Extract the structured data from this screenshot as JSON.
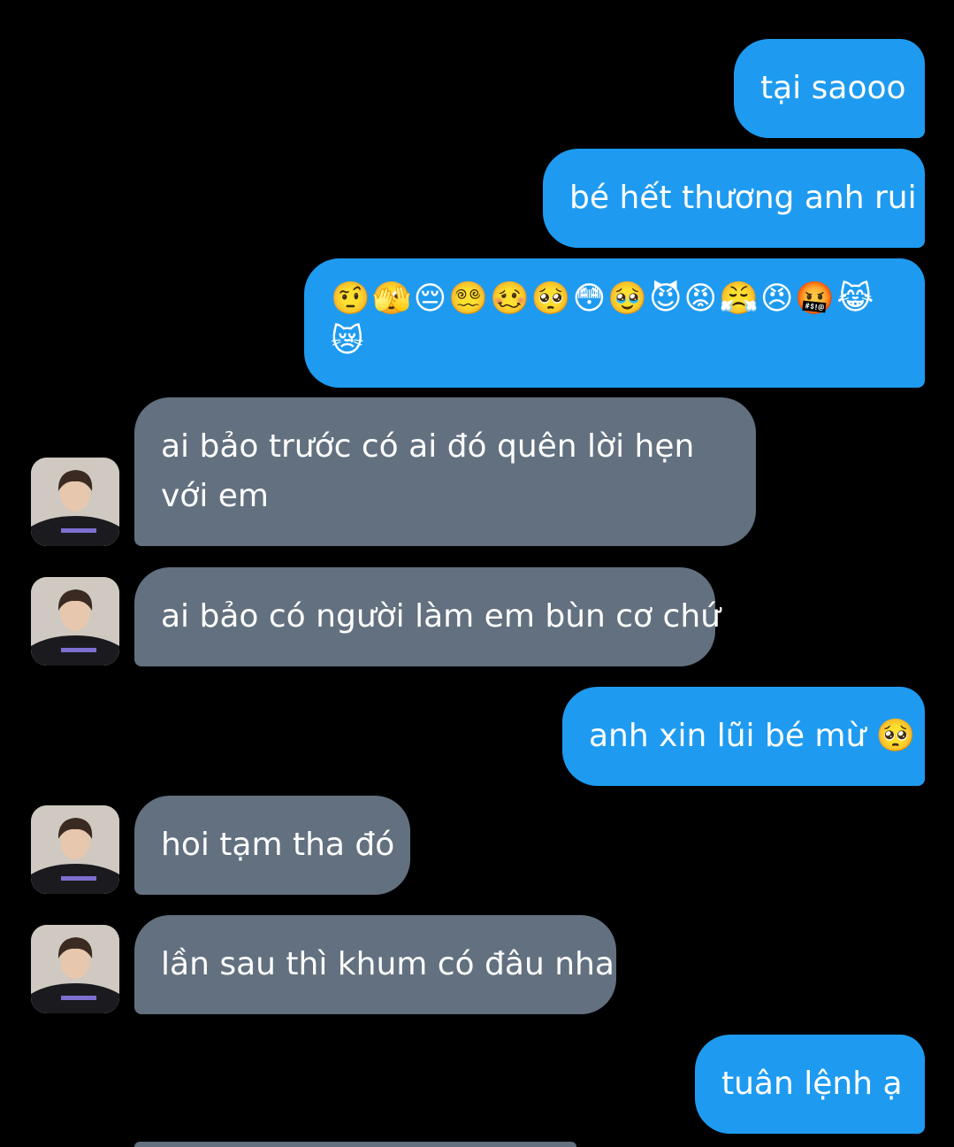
{
  "messages": [
    {
      "side": "sent",
      "text": "tại saooo"
    },
    {
      "side": "sent",
      "text": "bé hết thương anh rui"
    },
    {
      "side": "sent",
      "text": "🤨🫣😔😵‍💫🥴🥺😳🥹😈😡😤😠🤬😹😿"
    },
    {
      "side": "received",
      "text": "ai bảo trước có ai đó quên lời hẹn với em"
    },
    {
      "side": "received",
      "text": "ai bảo có người làm em bùn cơ chứ"
    },
    {
      "side": "sent",
      "text": "anh xin lũi bé mừ 🥺"
    },
    {
      "side": "received",
      "text": "hoi tạm tha đó"
    },
    {
      "side": "received",
      "text": "lần sau thì khum có đâu nha"
    },
    {
      "side": "sent",
      "text": "tuân lệnh ạ"
    }
  ],
  "colors": {
    "background": "#000000",
    "sent_bubble": "#1e9bf0",
    "received_bubble": "#62707f",
    "text": "#ffffff"
  },
  "icons": {
    "avatar": "profile-photo-avatar"
  }
}
